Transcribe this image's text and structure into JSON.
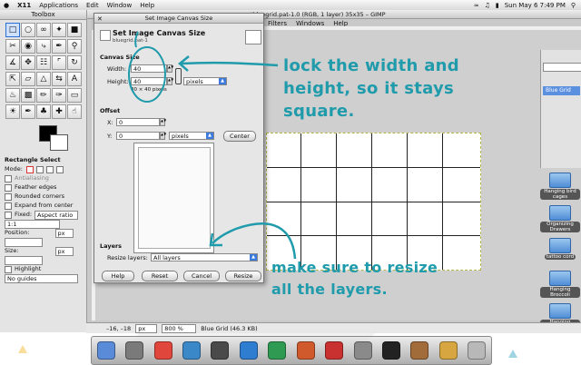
{
  "menubar": {
    "app": "X11",
    "items": [
      "Applications",
      "Edit",
      "Window",
      "Help"
    ],
    "clock": "Sun May 6  7:49 PM"
  },
  "toolbox": {
    "title": "Toolbox",
    "options_title": "Rectangle Select",
    "mode_label": "Mode:",
    "antialiasing": "Antialiasing",
    "feather": "Feather edges",
    "rounded": "Rounded corners",
    "expand": "Expand from center",
    "fixed": "Fixed:",
    "fixed_value": "Aspect ratio",
    "fixed_ratio": "1:1",
    "position": "Position:",
    "size": "Size:",
    "unit": "px",
    "highlight": "Highlight",
    "guides": "No guides"
  },
  "image_window": {
    "title": "*bluegrid.pat-1.0 (RGB, 1 layer) 35x35 – GIMP",
    "menus": [
      "Filters",
      "Windows",
      "Help"
    ],
    "status_unit": "px",
    "zoom": "800 %",
    "status_text": "Blue Grid (46.3 KB)",
    "coords": "–16, –18"
  },
  "layers_dock": {
    "selected_layer": "Blue Grid"
  },
  "desktop_icons": [
    "Hanging bird cages",
    "Organizing Drawers",
    "tattoo cord",
    "Hanging Broccoli",
    "Hanging planters"
  ],
  "dialog": {
    "window_title": "Set Image Canvas Size",
    "heading": "Set Image Canvas Size",
    "subheading": "bluegrid.pat-1",
    "canvas_size": "Canvas Size",
    "width_label": "Width:",
    "width_value": "40",
    "height_label": "Height:",
    "height_value": "40",
    "size_info": "40 × 40 pixels",
    "units": "pixels",
    "offset": "Offset",
    "x_label": "X:",
    "x_value": "0",
    "y_label": "Y:",
    "y_value": "0",
    "offset_units": "pixels",
    "center": "Center",
    "layers": "Layers",
    "resize_layers_label": "Resize layers:",
    "resize_layers_value": "All layers",
    "help": "Help",
    "reset": "Reset",
    "cancel": "Cancel",
    "resize": "Resize"
  },
  "annotations": {
    "lock_line1": "lock the width and",
    "lock_line2": "height, so it stays",
    "lock_line3": "square.",
    "resize_line1": "make sure to resize",
    "resize_line2": "all the layers."
  },
  "colors": {
    "annotation": "#1f9bab",
    "selection_blue": "#3b7be0"
  }
}
